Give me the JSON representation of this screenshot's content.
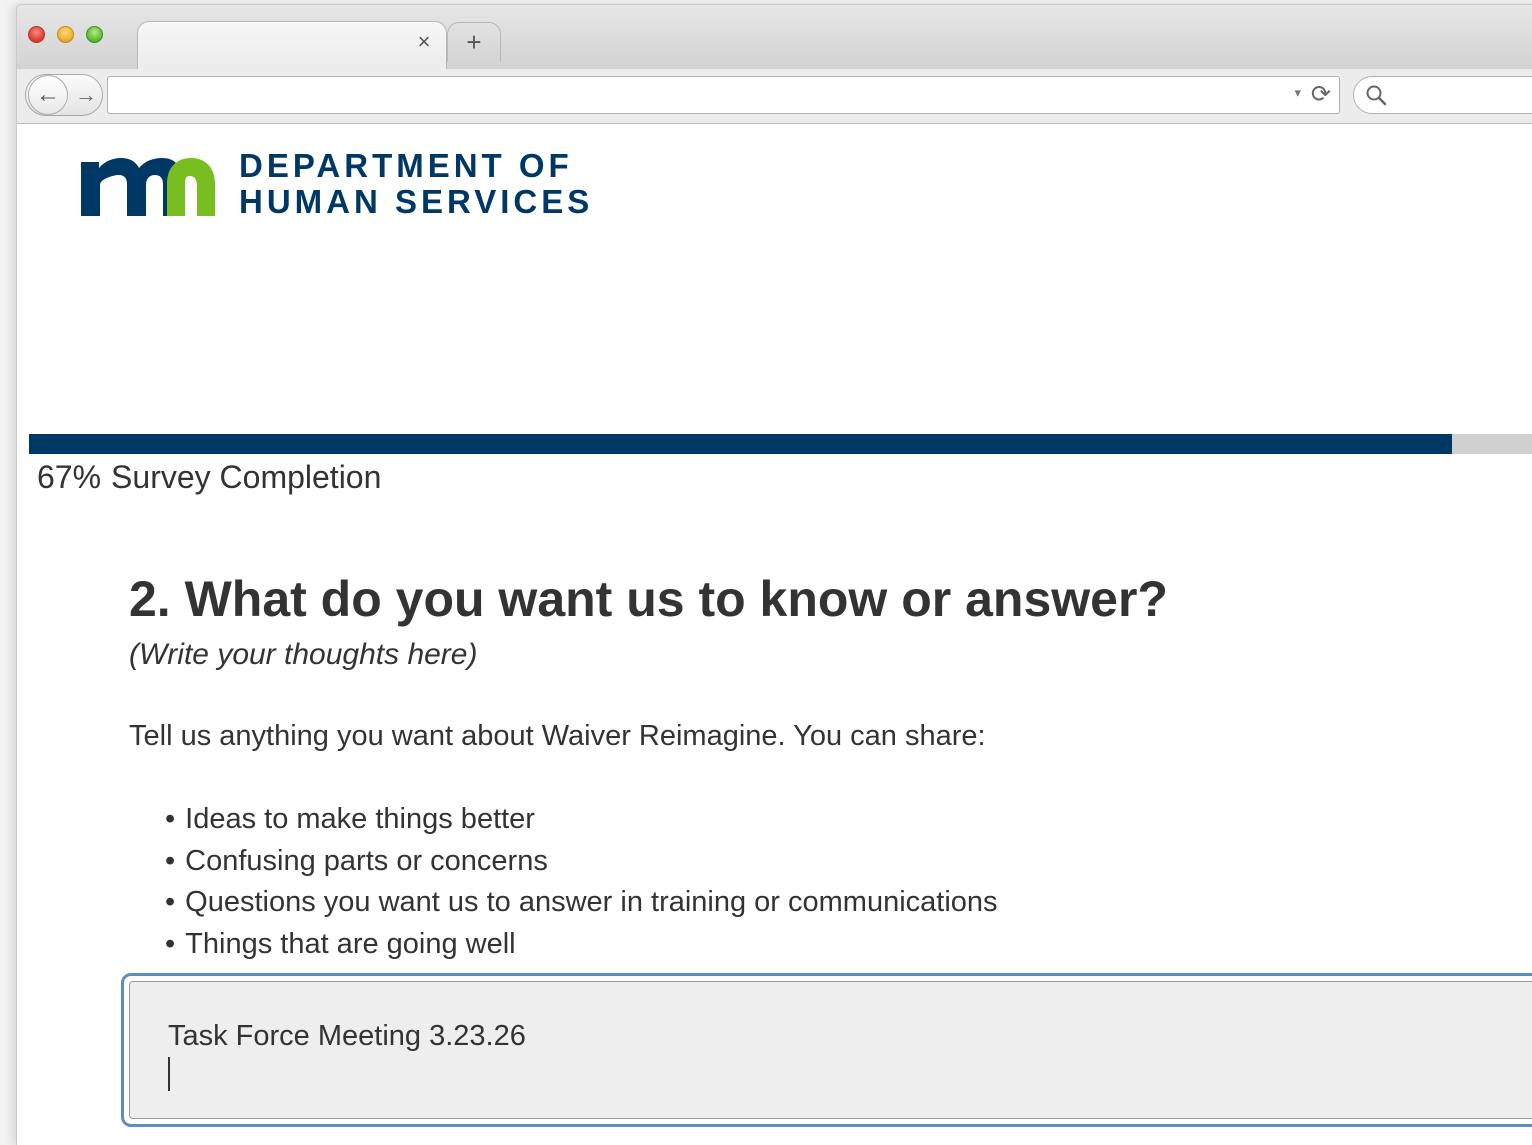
{
  "browser": {
    "tab_close_label": "×",
    "new_tab_label": "+",
    "back_label": "←",
    "forward_label": "→",
    "url_value": "",
    "url_dropdown_label": "▾",
    "reload_label": "⟳",
    "search_value": ""
  },
  "header": {
    "logo_mark": "mn",
    "logo_line1": "DEPARTMENT OF",
    "logo_line2": "HUMAN SERVICES"
  },
  "progress": {
    "percent_value": 0.67,
    "percent_text": "67%",
    "label": "Survey Completion"
  },
  "question": {
    "title": "2. What do you want us to know or answer?",
    "hint": "(Write your thoughts here)",
    "intro": "Tell us anything you want about Waiver Reimagine. You can share:",
    "bullets": [
      "Ideas to make things better",
      "Confusing parts or concerns",
      "Questions you want us to answer in training or communications",
      "Things that are going well"
    ],
    "answer_value": "Task Force Meeting 3.23.26"
  },
  "colors": {
    "brand_navy": "#003865",
    "brand_green": "#78BE20",
    "progress_track": "#d0d0d0",
    "focus_border": "#5a8fc0"
  }
}
